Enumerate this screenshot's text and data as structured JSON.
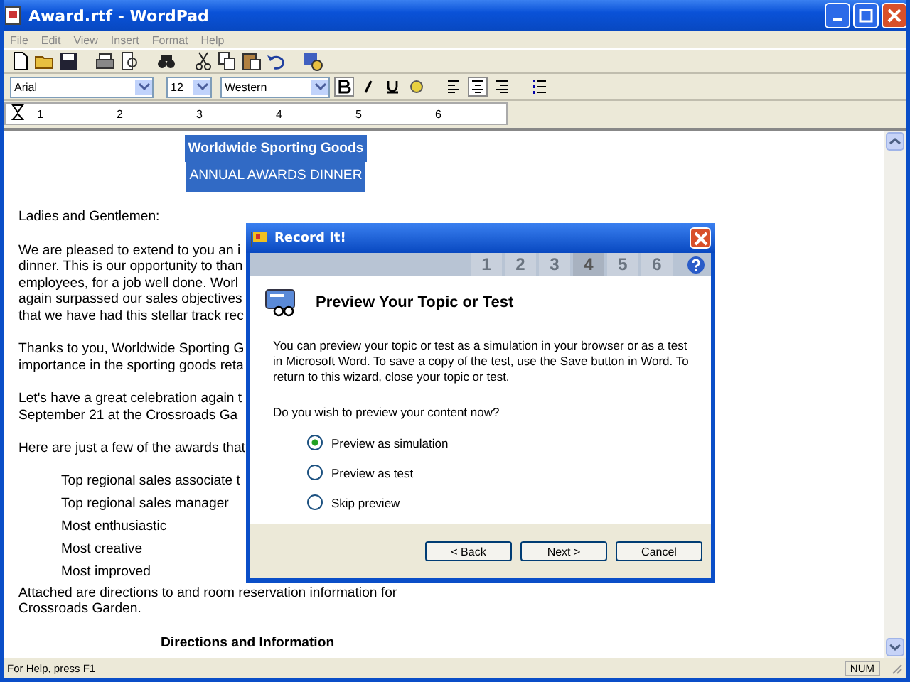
{
  "window": {
    "title": "Award.rtf - WordPad"
  },
  "menu": [
    "File",
    "Edit",
    "View",
    "Insert",
    "Format",
    "Help"
  ],
  "format_bar": {
    "font": "Arial",
    "size": "12",
    "script": "Western",
    "bold": true,
    "align_center": true
  },
  "ruler": {
    "labels": [
      "1",
      "2",
      "3",
      "4",
      "5",
      "6"
    ]
  },
  "document": [
    {
      "kind": "heading",
      "lines": [
        "Worldwide Sporting Goods",
        "ANNUAL AWARDS DINNER"
      ]
    },
    {
      "kind": "body",
      "lines": [
        "Ladies and Gentlemen:"
      ]
    },
    {
      "kind": "body",
      "lines": [
        "We are pleased to extend to you an i",
        "dinner.  This is our opportunity to than",
        "employees, for a job well done.  Worl",
        "again surpassed our sales objectives",
        "that we have had this stellar track rec"
      ]
    },
    {
      "kind": "body",
      "lines": [
        "Thanks to you, Worldwide Sporting G",
        "importance in the sporting goods reta"
      ]
    },
    {
      "kind": "body",
      "lines": [
        "Let's have a great celebration again t",
        "September 21 at the Crossroads Ga"
      ]
    },
    {
      "kind": "body",
      "lines": [
        "Here are just a few of the awards that"
      ]
    },
    {
      "kind": "award",
      "lines": [
        "Top regional sales associate t",
        "Top regional sales manager",
        "Most enthusiastic",
        "Most creative",
        "Most improved"
      ]
    },
    {
      "kind": "body",
      "lines": [
        "Attached are directions to and room reservation information for",
        "Crossroads Garden."
      ]
    },
    {
      "kind": "subheading",
      "lines": [
        "Directions and Information"
      ]
    }
  ],
  "dialog": {
    "title": "Record It!",
    "steps": [
      {
        "label": "1",
        "selected": false
      },
      {
        "label": "2",
        "selected": false
      },
      {
        "label": "3",
        "selected": false
      },
      {
        "label": "4",
        "selected": true
      },
      {
        "label": "5",
        "selected": false
      },
      {
        "label": "6",
        "selected": false
      }
    ],
    "heading": "Preview Your Topic or Test",
    "description": "You can preview your topic or test as a simulation in your browser or as a test in Microsoft Word. To save a copy of the test, use the Save button in Word. To return to this wizard, close your topic or test.",
    "question": "Do you wish to preview your content now?",
    "options": [
      {
        "label": "Preview as simulation",
        "selected": true
      },
      {
        "label": "Preview as test",
        "selected": false
      },
      {
        "label": "Skip preview",
        "selected": false
      }
    ],
    "buttons": [
      "< Back",
      "Next >",
      "Cancel"
    ]
  },
  "status_bar": {
    "help": "For Help, press F1",
    "num_lock": "NUM"
  }
}
